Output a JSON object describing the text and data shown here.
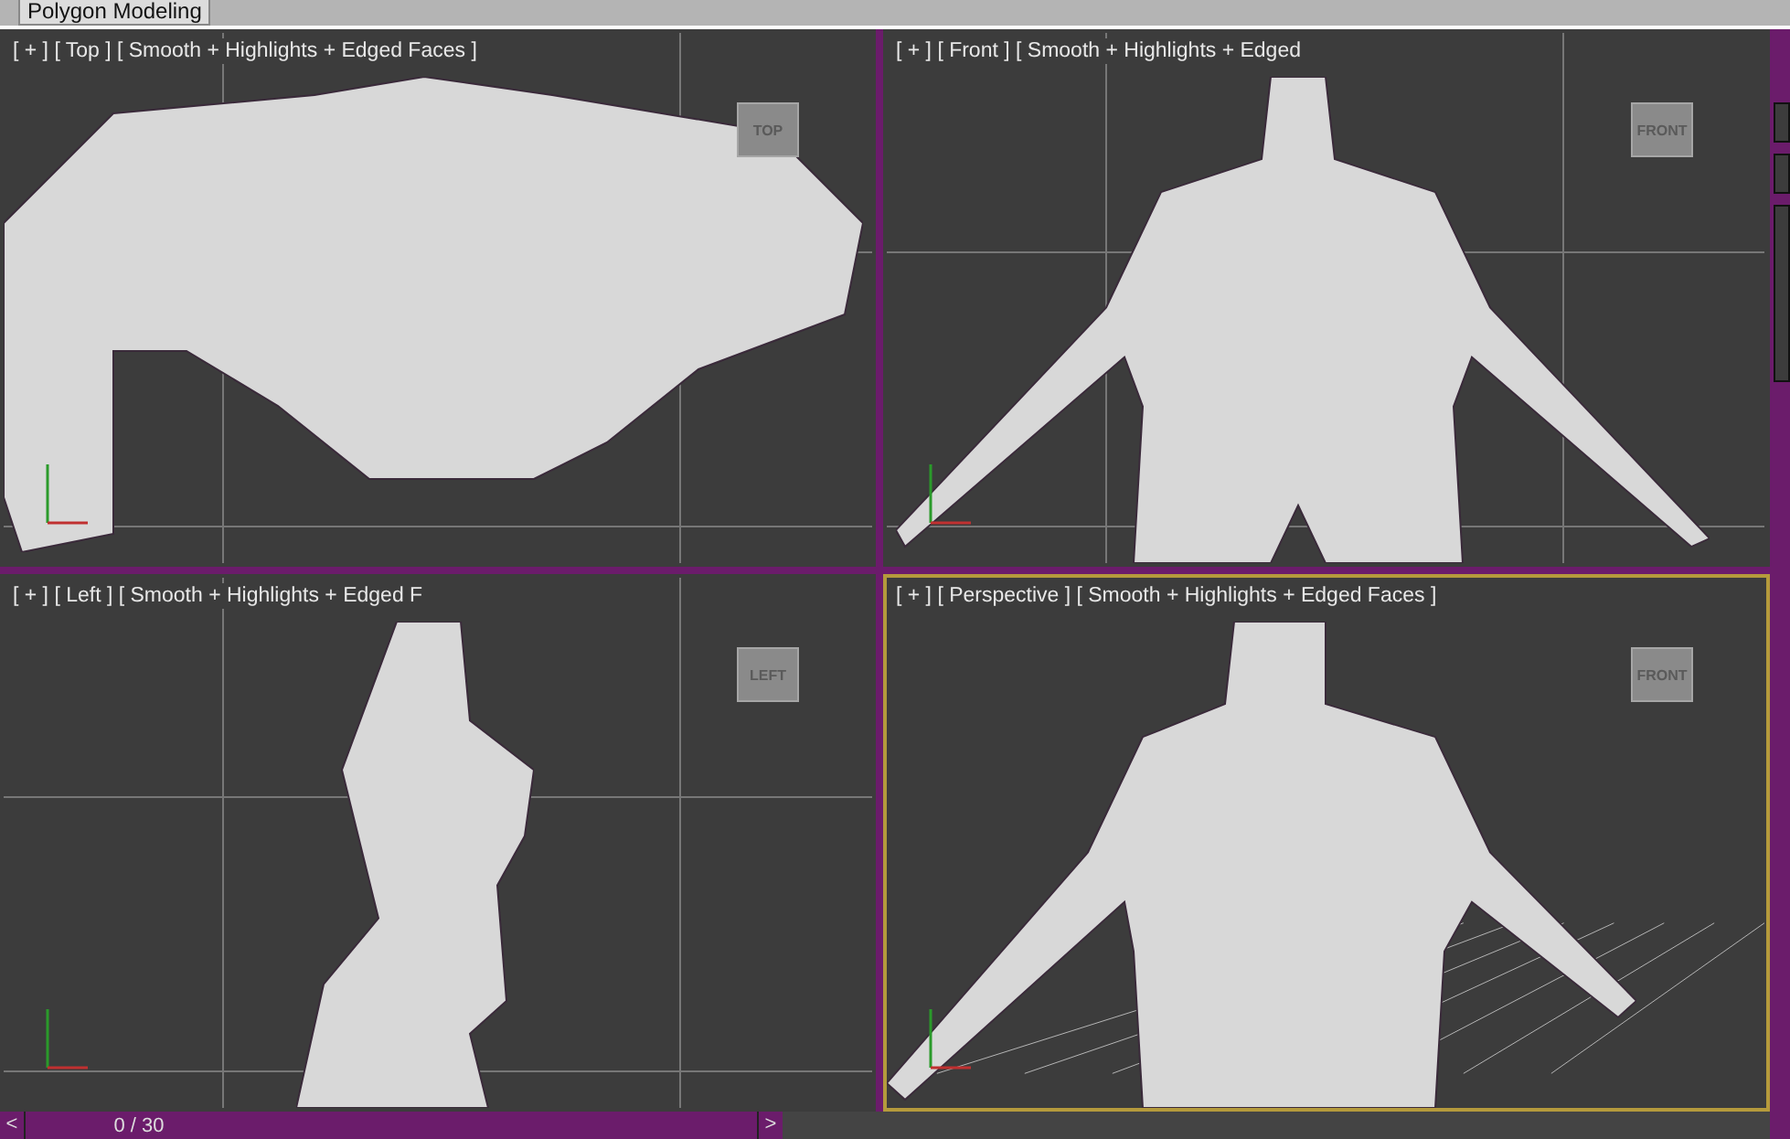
{
  "ribbon_tab": "Polygon Modeling",
  "viewports": [
    {
      "kind": "top",
      "label": "[ + ] [ Top ] [ Smooth + Highlights + Edged Faces ]",
      "cube_label": "TOP",
      "active": false
    },
    {
      "kind": "front",
      "label": "[ + ] [ Front ] [ Smooth + Highlights + Edged",
      "cube_label": "FRONT",
      "active": false
    },
    {
      "kind": "left",
      "label": "[ + ] [ Left ] [ Smooth + Highlights + Edged F",
      "cube_label": "LEFT",
      "active": false
    },
    {
      "kind": "perspective",
      "label": "[ + ] [ Perspective ] [ Smooth + Highlights + Edged Faces ]",
      "cube_label": "FRONT",
      "active": true
    }
  ],
  "time_slider": {
    "prev": "<",
    "position": "0 / 30",
    "next": ">",
    "level": 0
  }
}
